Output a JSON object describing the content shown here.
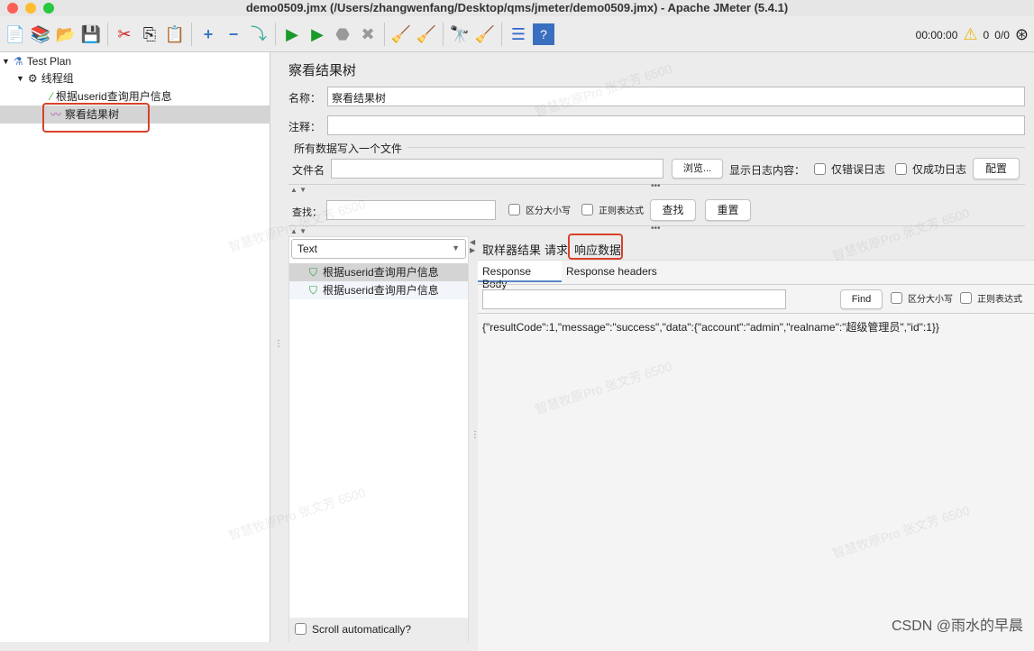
{
  "window": {
    "title": "demo0509.jmx (/Users/zhangwenfang/Desktop/qms/jmeter/demo0509.jmx) - Apache JMeter (5.4.1)"
  },
  "toolbar": {
    "icons": [
      "new-icon",
      "templates-icon",
      "open-icon",
      "save-icon",
      "cut-icon",
      "copy-icon",
      "paste-icon",
      "expand-icon",
      "collapse-icon",
      "toggle-icon",
      "start-icon",
      "start-no-pauses-icon",
      "stop-icon",
      "shutdown-icon",
      "clear-icon",
      "clear-all-icon",
      "search-icon",
      "reset-search-icon",
      "function-helper-icon",
      "help-icon"
    ],
    "timer": "00:00:00",
    "warnings": "0",
    "threads": "0/0"
  },
  "tree": {
    "items": [
      {
        "label": "Test Plan"
      },
      {
        "label": "线程组"
      },
      {
        "label": "根据userid查询用户信息"
      },
      {
        "label": "察看结果树"
      }
    ]
  },
  "panel": {
    "title": "察看结果树",
    "name_label": "名称：",
    "name_value": "察看结果树",
    "comment_label": "注释：",
    "comment_value": "",
    "file_section": "所有数据写入一个文件",
    "filename_label": "文件名",
    "filename_value": "",
    "browse": "浏览...",
    "log_label": "显示日志内容：",
    "errors_only": "仅错误日志",
    "success_only": "仅成功日志",
    "configure": "配置",
    "search_label": "查找：",
    "search_value": "",
    "case_sensitive": "区分大小写",
    "regex": "正则表达式",
    "find": "查找",
    "reset": "重置"
  },
  "results": {
    "renderer": "Text",
    "samples": [
      {
        "label": "根据userid查询用户信息"
      },
      {
        "label": "根据userid查询用户信息"
      }
    ],
    "scroll_auto": "Scroll automatically?"
  },
  "detail": {
    "tabs": [
      "取样器结果",
      "请求",
      "响应数据"
    ],
    "active_tab": "响应数据",
    "subtabs": [
      "Response Body",
      "Response headers"
    ],
    "find_value": "",
    "find": "Find",
    "case_sensitive": "区分大小写",
    "regex": "正则表达式",
    "body": "{\"resultCode\":1,\"message\":\"success\",\"data\":{\"account\":\"admin\",\"realname\":\"超级管理员\",\"id\":1}}"
  },
  "watermark": "智慧牧原Pro 张文芳 6500",
  "credit": "CSDN @雨水的早晨",
  "colors": {
    "highlight": "#d9412b",
    "tab_underline": "#5a87c6",
    "success": "#2a9d3a"
  }
}
